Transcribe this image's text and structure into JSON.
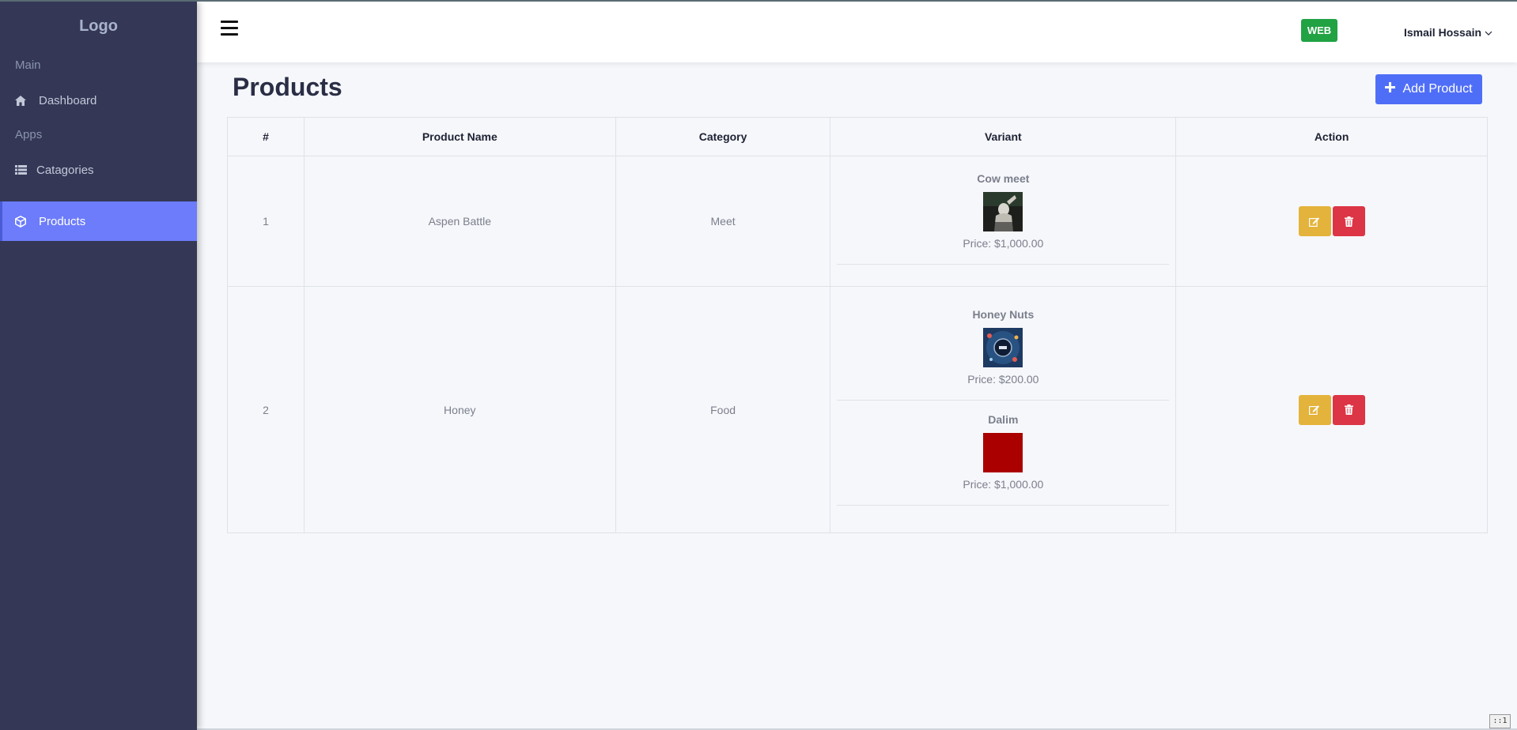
{
  "sidebar": {
    "logo": "Logo",
    "sections": [
      "Main",
      "Apps"
    ],
    "items": [
      {
        "label": "Dashboard",
        "icon": "home-icon"
      },
      {
        "label": "Catagories",
        "icon": "list-icon"
      },
      {
        "label": "Products",
        "icon": "cube-icon",
        "active": true
      }
    ]
  },
  "header": {
    "web_badge": "WEB",
    "user_name": "Ismail Hossain"
  },
  "page": {
    "title": "Products",
    "add_button": "Add Product"
  },
  "table": {
    "columns": [
      "#",
      "Product Name",
      "Category",
      "Variant",
      "Action"
    ],
    "rows": [
      {
        "index": "1",
        "name": "Aspen Battle",
        "category": "Meet",
        "variants": [
          {
            "name": "Cow meet",
            "price": "Price: $1,000.00"
          }
        ]
      },
      {
        "index": "2",
        "name": "Honey",
        "category": "Food",
        "variants": [
          {
            "name": "Honey Nuts",
            "price": "Price: $200.00"
          },
          {
            "name": "Dalim",
            "price": "Price: $1,000.00"
          }
        ]
      }
    ]
  },
  "colors": {
    "sidebar_bg": "#343856",
    "active_item": "#6c7cfa",
    "primary_button": "#4f6ef7",
    "edit_button": "#e4b33b",
    "delete_button": "#dc3545",
    "web_badge": "#21a243"
  },
  "corner_label": "::1"
}
